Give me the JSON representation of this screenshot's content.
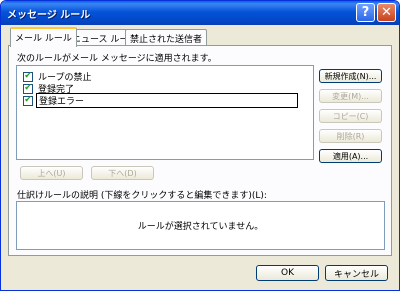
{
  "window": {
    "title": "メッセージ ルール",
    "help_label": "?",
    "close_label": "✕"
  },
  "tabs": [
    {
      "label": "メール ルール",
      "active": true
    },
    {
      "label": "ニュース ルール",
      "active": false
    },
    {
      "label": "禁止された送信者",
      "active": false
    }
  ],
  "rules_panel": {
    "heading": "次のルールがメール メッセージに適用されます。",
    "rules": [
      {
        "label": "ループの禁止",
        "checked": true
      },
      {
        "label": "登録完了",
        "checked": true
      },
      {
        "label": "登録エラー",
        "checked": true
      }
    ]
  },
  "side_buttons": {
    "new": "新規作成(N)...",
    "modify": "変更(M)...",
    "copy": "コピー(C)",
    "delete": "削除(R)",
    "apply": "適用(A)..."
  },
  "move_buttons": {
    "up": "上へ(U)",
    "down": "下へ(D)"
  },
  "description": {
    "label": "仕訳けルールの説明 (下線をクリックすると編集できます)(L):",
    "text": "ルールが選択されていません。"
  },
  "footer": {
    "ok": "OK",
    "cancel": "キャンセル"
  }
}
